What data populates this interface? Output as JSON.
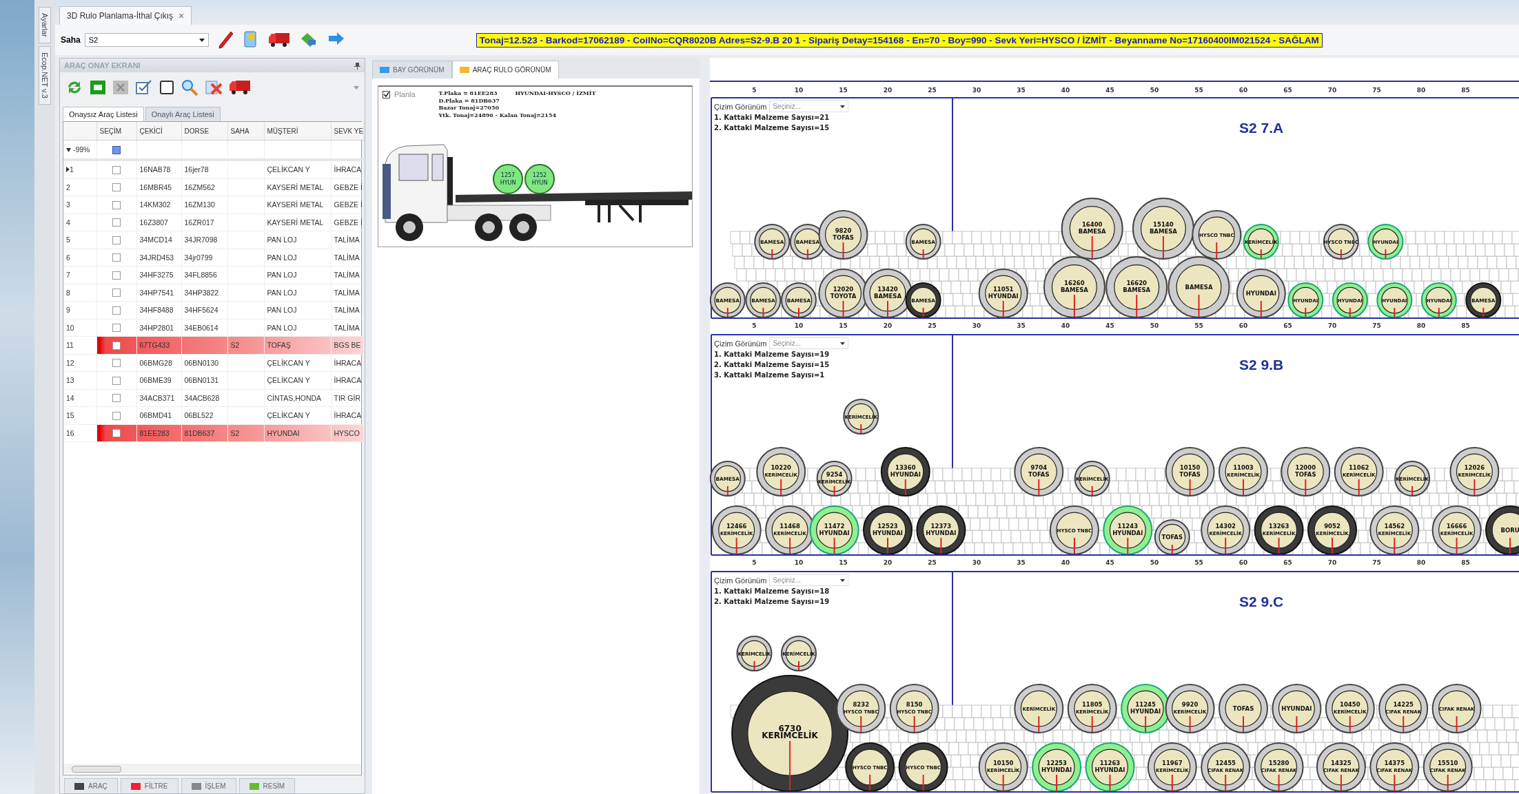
{
  "document_tab": {
    "title": "3D Rulo Planlama-İthal Çıkış",
    "close": "×"
  },
  "side_tabs": [
    "Ayarlar",
    "Ecop.NET v.3"
  ],
  "toolbar": {
    "label": "Saha",
    "value": "S2"
  },
  "info_bar": "Tonaj=12.523 - Barkod=17062189 - CoilNo=CQR8020B Adres=S2-9.B 20 1 - Sipariş Detay=154168 - En=70 - Boy=990 - Sevk Yeri=HYSCO /  İZMİT - Beyanname No=17160400IM021524 - SAĞLAM",
  "left_panel": {
    "title": "ARAÇ ONAY EKRANI",
    "tabs": [
      {
        "label": "Onaysız Araç Listesi",
        "selected": true
      },
      {
        "label": "Onaylı Araç Listesi",
        "selected": false
      }
    ],
    "columns": [
      "SEÇİM",
      "ÇEKİCİ",
      "DORSE",
      "SAHA",
      "MÜŞTERİ",
      "SEVK YE"
    ],
    "filter": "-99%",
    "select_all_checked": true,
    "rows": [
      {
        "no": "1",
        "current": true,
        "checked": false,
        "flagged": false,
        "cekici": "16NAB78",
        "dorse": "16jer78",
        "musteri": "ÇELİKCAN Y",
        "sevk": "İHRACA"
      },
      {
        "no": "2",
        "current": false,
        "checked": false,
        "flagged": false,
        "cekici": "16MBR45",
        "dorse": "16ZM562",
        "musteri": "KAYSERİ METAL",
        "sevk": "GEBZE İ"
      },
      {
        "no": "3",
        "current": false,
        "checked": false,
        "flagged": false,
        "cekici": "14KM302",
        "dorse": "16ZM130",
        "musteri": "KAYSERİ METAL",
        "sevk": "GEBZE İ"
      },
      {
        "no": "4",
        "current": false,
        "checked": false,
        "flagged": false,
        "cekici": "16Z3807",
        "dorse": "16ZR017",
        "musteri": "KAYSERİ METAL",
        "sevk": "GEBZE İ"
      },
      {
        "no": "5",
        "current": false,
        "checked": false,
        "flagged": false,
        "cekici": "34MCD14",
        "dorse": "34JR7098",
        "musteri": "PAN LOJ",
        "sevk": "TALİMA"
      },
      {
        "no": "6",
        "current": false,
        "checked": false,
        "flagged": false,
        "cekici": "34JRD453",
        "dorse": "34jr0799",
        "musteri": "PAN LOJ",
        "sevk": "TALİMA"
      },
      {
        "no": "7",
        "current": false,
        "checked": false,
        "flagged": false,
        "cekici": "34HF3275",
        "dorse": "34FL8856",
        "musteri": "PAN LOJ",
        "sevk": "TALİMA"
      },
      {
        "no": "8",
        "current": false,
        "checked": false,
        "flagged": false,
        "cekici": "34HP7541",
        "dorse": "34HP3822",
        "musteri": "PAN LOJ",
        "sevk": "TALİMA"
      },
      {
        "no": "9",
        "current": false,
        "checked": false,
        "flagged": false,
        "cekici": "34HF8488",
        "dorse": "34HF5624",
        "musteri": "PAN LOJ",
        "sevk": "TALİMA"
      },
      {
        "no": "10",
        "current": false,
        "checked": false,
        "flagged": false,
        "cekici": "34HP2801",
        "dorse": "34EB0614",
        "musteri": "PAN LOJ",
        "sevk": "TALİMA"
      },
      {
        "no": "11",
        "current": false,
        "checked": false,
        "flagged": true,
        "cekici": "67TG433",
        "saha": "S2",
        "musteri": "TOFAŞ",
        "sevk": "BGS BE"
      },
      {
        "no": "12",
        "current": false,
        "checked": false,
        "flagged": false,
        "cekici": "06BMG28",
        "dorse": "06BN0130",
        "musteri": "ÇELİKCAN Y",
        "sevk": "İHRACA"
      },
      {
        "no": "13",
        "current": false,
        "checked": false,
        "flagged": false,
        "cekici": "06BME39",
        "dorse": "06BN0131",
        "musteri": "ÇELİKCAN Y",
        "sevk": "İHRACA"
      },
      {
        "no": "14",
        "current": false,
        "checked": false,
        "flagged": false,
        "cekici": "34ACB371",
        "dorse": "34ACB628",
        "musteri": "CİNTAS,HONDA",
        "sevk": "TIR GİR"
      },
      {
        "no": "15",
        "current": false,
        "checked": false,
        "flagged": false,
        "cekici": "06BMD41",
        "dorse": "06BL522",
        "musteri": "ÇELİKCAN Y",
        "sevk": "İHRACA"
      },
      {
        "no": "16",
        "current": false,
        "checked": false,
        "flagged": true,
        "cekici": "81EE283",
        "dorse": "81DB637",
        "saha": "S2",
        "musteri": "HYUNDAI",
        "sevk": "HYSCO"
      }
    ],
    "bottom_tabs": [
      "ARAÇ",
      "FİLTRE",
      "İŞLEM",
      "RESİM"
    ]
  },
  "view_tabs": [
    {
      "label": "BAY GÖRÜNÜM",
      "selected": false
    },
    {
      "label": "ARAÇ RULO GÖRÜNÜM",
      "selected": true
    }
  ],
  "truck": {
    "planla": {
      "label": "Planla",
      "checked": true
    },
    "plate_lines": [
      "T.Plaka = 81EE283",
      "D.Plaka = 81DB637",
      "Bazar Tonaj=27050",
      "Ytk. Tonaj=24896  - Kalan Tonaj=2154"
    ],
    "destination": "HYUNDAI-HYSCO / İZMİT",
    "coils": [
      {
        "number": "1257",
        "name": "HYUN"
      },
      {
        "number": "1252",
        "name": "HYUN"
      }
    ]
  },
  "top_ruler_ticks": [
    "5",
    "10",
    "15",
    "20",
    "25",
    "30",
    "35",
    "40",
    "45",
    "50",
    "55",
    "60",
    "65",
    "70",
    "75",
    "80",
    "85"
  ],
  "bays": [
    {
      "title": "S2 7.A",
      "view_label": "Çizim Görünüm",
      "view_placeholder": "Seçiniz...",
      "counts": [
        "1. Kattaki Malzeme Sayısı=21",
        "2. Kattaki Malzeme Sayısı=15"
      ],
      "ticks": [
        "5",
        "10",
        "15",
        "20",
        "25",
        "30",
        "35",
        "40",
        "45",
        "50",
        "55",
        "60",
        "65",
        "70",
        "75",
        "80",
        "85"
      ],
      "layers": [
        {
          "coils": [
            {
              "kind": "normal",
              "name": "BAMESA"
            },
            {
              "kind": "normal",
              "name": "BAMESA"
            },
            {
              "kind": "normal",
              "number": "9820",
              "name": "TOFAS"
            },
            {
              "kind": "normal",
              "name": "BAMESA"
            },
            {
              "kind": "normal",
              "number": "16400",
              "name": "BAMESA"
            },
            {
              "kind": "normal",
              "number": "15140",
              "name": "BAMESA"
            },
            {
              "kind": "normal",
              "name": "HYSCO TNBC"
            },
            {
              "kind": "green",
              "name": "KERİMCELİK"
            },
            {
              "kind": "normal",
              "name": "HYSCO TNBC"
            },
            {
              "kind": "green",
              "name": "HYUNDAI"
            }
          ]
        },
        {
          "coils": [
            {
              "kind": "normal",
              "name": "BAMESA"
            },
            {
              "kind": "normal",
              "name": "BAMESA"
            },
            {
              "kind": "normal",
              "name": "BAMESA"
            },
            {
              "kind": "normal",
              "number": "12020",
              "name": "TOYOTA"
            },
            {
              "kind": "normal",
              "number": "13420",
              "name": "BAMESA"
            },
            {
              "kind": "dark",
              "name": "BAMESA"
            },
            {
              "kind": "normal",
              "number": "11051",
              "name": "HYUNDAI"
            },
            {
              "kind": "normal",
              "number": "16260",
              "name": "BAMESA"
            },
            {
              "kind": "normal",
              "number": "16620",
              "name": "BAMESA"
            },
            {
              "kind": "normal",
              "name": "BAMESA"
            },
            {
              "kind": "normal",
              "name": "HYUNDAI"
            },
            {
              "kind": "green",
              "name": "HYUNDAI"
            },
            {
              "kind": "green",
              "name": "HYUNDAI"
            },
            {
              "kind": "green",
              "name": "HYUNDAI"
            },
            {
              "kind": "green",
              "name": "HYUNDAI"
            },
            {
              "kind": "dark",
              "name": "BAMESA"
            }
          ]
        }
      ]
    },
    {
      "title": "S2 9.B",
      "view_label": "Çizim Görünüm",
      "view_placeholder": "Seçiniz...",
      "counts": [
        "1. Kattaki Malzeme Sayısı=19",
        "2. Kattaki Malzeme Sayısı=15",
        "3. Kattaki Malzeme Sayısı=1"
      ],
      "ticks": [
        "5",
        "10",
        "15",
        "20",
        "25",
        "30",
        "35",
        "40",
        "45",
        "50",
        "55",
        "60",
        "65",
        "70",
        "75",
        "80",
        "85"
      ],
      "layers": [
        {
          "coils": [
            {
              "kind": "normal",
              "name": "KERİMCELİK"
            }
          ]
        },
        {
          "coils": [
            {
              "kind": "normal",
              "name": "BAMESA"
            },
            {
              "kind": "normal",
              "number": "10220",
              "name": "KERİMCELİK"
            },
            {
              "kind": "normal",
              "number": "9254",
              "name": "KERİMCELİK"
            },
            {
              "kind": "dark",
              "number": "13360",
              "name": "HYUNDAI"
            },
            {
              "kind": "normal",
              "number": "9704",
              "name": "TOFAS"
            },
            {
              "kind": "normal",
              "name": "KERİMCELİK"
            },
            {
              "kind": "normal",
              "number": "10150",
              "name": "TOFAS"
            },
            {
              "kind": "normal",
              "number": "11003",
              "name": "KERİMCELİK"
            },
            {
              "kind": "normal",
              "number": "12000",
              "name": "TOFAS"
            },
            {
              "kind": "normal",
              "number": "11062",
              "name": "KERİMCELİK"
            },
            {
              "kind": "normal",
              "name": "KERİMCELİK"
            },
            {
              "kind": "normal",
              "number": "12026",
              "name": "KERİMCELİK"
            }
          ]
        },
        {
          "coils": [
            {
              "kind": "normal",
              "number": "12466",
              "name": "KERİMCELİK"
            },
            {
              "kind": "normal",
              "number": "11468",
              "name": "KERİMCELİK"
            },
            {
              "kind": "green",
              "number": "11472",
              "name": "HYUNDAI"
            },
            {
              "kind": "dark",
              "number": "12523",
              "name": "HYUNDAI"
            },
            {
              "kind": "dark",
              "number": "12373",
              "name": "HYUNDAI"
            },
            {
              "kind": "normal",
              "name": "HYSCO TNBC"
            },
            {
              "kind": "green",
              "number": "11243",
              "name": "HYUNDAI"
            },
            {
              "kind": "normal",
              "name": "TOFAS"
            },
            {
              "kind": "normal",
              "number": "14302",
              "name": "KERİMCELİK"
            },
            {
              "kind": "dark",
              "number": "13263",
              "name": "KERİMCELİK"
            },
            {
              "kind": "dark",
              "number": "9052",
              "name": "KERİMCELİK"
            },
            {
              "kind": "normal",
              "number": "14562",
              "name": "KERİMCELİK"
            },
            {
              "kind": "normal",
              "number": "16666",
              "name": "KERİMCELİK"
            },
            {
              "kind": "dark",
              "name": "BORU"
            }
          ]
        }
      ]
    },
    {
      "title": "S2 9.C",
      "view_label": "Çizim Görünüm",
      "view_placeholder": "Seçiniz...",
      "counts": [
        "1. Kattaki Malzeme Sayısı=18",
        "2. Kattaki Malzeme Sayısı=19"
      ],
      "layers": [
        {
          "coils": [
            {
              "kind": "normal",
              "name": "KERİMCELİK"
            },
            {
              "kind": "normal",
              "name": "KERİMCELİK"
            }
          ]
        },
        {
          "coils": [
            {
              "kind": "normal",
              "number": "8232",
              "name": "HYSCO TNBC"
            },
            {
              "kind": "normal",
              "number": "8150",
              "name": "HYSCO TNBC"
            },
            {
              "kind": "normal",
              "name": "KERİMCELİK"
            },
            {
              "kind": "normal",
              "number": "11805",
              "name": "KERİMCELİK"
            },
            {
              "kind": "green",
              "number": "11245",
              "name": "HYUNDAI"
            },
            {
              "kind": "normal",
              "number": "9920",
              "name": "KERİMCELİK"
            },
            {
              "kind": "normal",
              "name": "TOFAS"
            },
            {
              "kind": "normal",
              "name": "HYUNDAI"
            },
            {
              "kind": "normal",
              "number": "10450",
              "name": "KERİMCELİK"
            },
            {
              "kind": "normal",
              "number": "14225",
              "name": "CIFAK RENAK"
            },
            {
              "kind": "normal",
              "name": "CIFAK RENAK"
            }
          ]
        },
        {
          "coils": [
            {
              "kind": "dark",
              "number": "6730",
              "name": "KERİMCELİK"
            },
            {
              "kind": "dark",
              "name": "HYSCO TNBC"
            },
            {
              "kind": "dark",
              "name": "HYSCO TNBC"
            },
            {
              "kind": "normal",
              "number": "10150",
              "name": "KERİMCELİK"
            },
            {
              "kind": "green",
              "number": "12253",
              "name": "HYUNDAI"
            },
            {
              "kind": "green",
              "number": "11263",
              "name": "HYUNDAI"
            },
            {
              "kind": "normal",
              "number": "11967",
              "name": "KERİMCELİK"
            },
            {
              "kind": "normal",
              "number": "12455",
              "name": "CIFAK RENAK"
            },
            {
              "kind": "normal",
              "number": "15280",
              "name": "CIFAK RENAK"
            },
            {
              "kind": "normal",
              "number": "14325",
              "name": "CIFAK RENAK"
            },
            {
              "kind": "normal",
              "number": "14375",
              "name": "CIFAK RENAK"
            },
            {
              "kind": "normal",
              "number": "15510",
              "name": "CIFAK RENAK"
            }
          ]
        }
      ]
    }
  ]
}
